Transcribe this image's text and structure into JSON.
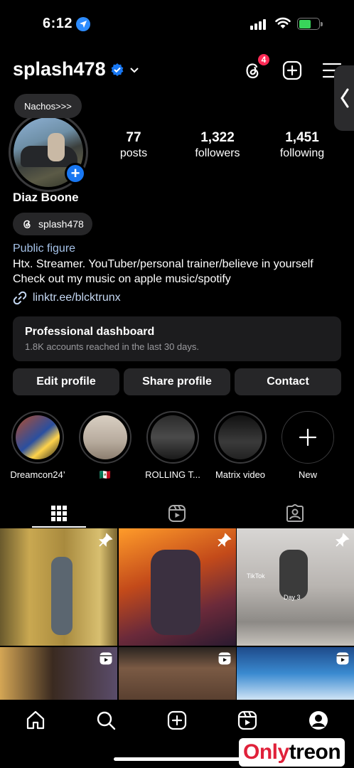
{
  "status": {
    "time": "6:12"
  },
  "header": {
    "username": "splash478",
    "threads_badge": "4"
  },
  "profile": {
    "note": "Nachos>>>",
    "name": "Diaz Boone",
    "threads_handle": "splash478",
    "category": "Public figure",
    "bio_line1": "Htx. Streamer. YouTuber/personal trainer/believe in yourself",
    "bio_line2": "Check out my music on apple music/spotify",
    "link": "linktr.ee/blcktrunx",
    "stats": [
      {
        "value": "77",
        "label": "posts"
      },
      {
        "value": "1,322",
        "label": "followers"
      },
      {
        "value": "1,451",
        "label": "following"
      }
    ]
  },
  "dashboard": {
    "title": "Professional dashboard",
    "subtitle": "1.8K accounts reached in the last 30 days."
  },
  "buttons": {
    "edit": "Edit profile",
    "share": "Share profile",
    "contact": "Contact"
  },
  "highlights": [
    {
      "label": "Dreamcon24’"
    },
    {
      "label": "🇲🇽"
    },
    {
      "label": "ROLLING T..."
    },
    {
      "label": "Matrix video"
    },
    {
      "label": "New"
    }
  ],
  "grid_text": {
    "day3": "Day 3",
    "tiktok": "TikTok"
  },
  "watermark": {
    "brand_a": "Only",
    "brand_b": "treon"
  },
  "colors": {
    "accent": "#1877f2",
    "link": "#a5c2e8",
    "badge": "#ff2a55"
  }
}
